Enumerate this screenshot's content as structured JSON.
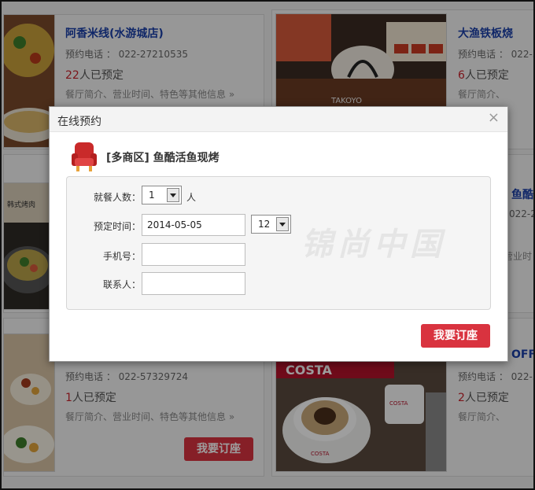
{
  "restaurants": [
    {
      "name": "阿香米线(水游城店)",
      "phone_label": "预约电话 ：",
      "phone": "022-27210535",
      "count": "22",
      "count_suffix": "人已预定",
      "more": "餐厅简介、营业时间、特色等其他信息 »"
    },
    {
      "name": "大渔铁板烧",
      "phone_label": "预约电话 ：",
      "phone": "022-5",
      "count": "6",
      "count_suffix": "人已预定",
      "more": "餐厅简介、"
    },
    {
      "name": "鱼酷",
      "phone_label": "",
      "phone": "022-2",
      "count": "",
      "count_suffix": "",
      "more": "营业时"
    },
    {
      "name": "",
      "phone_label": "预约电话 ：",
      "phone": "022-57329724",
      "count": "1",
      "count_suffix": "人已预定",
      "more": "餐厅简介、营业时间、特色等其他信息 »",
      "button": "我要订座"
    },
    {
      "name": "OFFE",
      "phone_label": "预约电话 ：",
      "phone": "022-5",
      "count": "2",
      "count_suffix": "人已预定",
      "more": "餐厅简介、"
    }
  ],
  "partial_left_rows": [
    "022-2",
    "营业时"
  ],
  "photo_text": {
    "costa_sign": "COSTA",
    "cup_brand": "COSTA",
    "mug_brand": "COSTA",
    "korean_sign": "韩式烤肉",
    "sushi_caption": "TAKOYO"
  },
  "dialog": {
    "title": "在线预约",
    "close": "×",
    "restaurant": "[多商区] 鱼酷活鱼现烤",
    "fields": {
      "diners_label": "就餐人数：",
      "diners_value": "1",
      "diners_unit": "人",
      "time_label": "预定时间：",
      "date_value": "2014-05-05",
      "hour_value": "12",
      "phone_label": "手机号：",
      "phone_value": "",
      "contact_label": "联系人：",
      "contact_value": ""
    },
    "watermark": "锦尚中国",
    "submit": "我要订座"
  },
  "colors": {
    "accent": "#d9333f",
    "link": "#1a3fa8",
    "count": "#c8232c"
  }
}
